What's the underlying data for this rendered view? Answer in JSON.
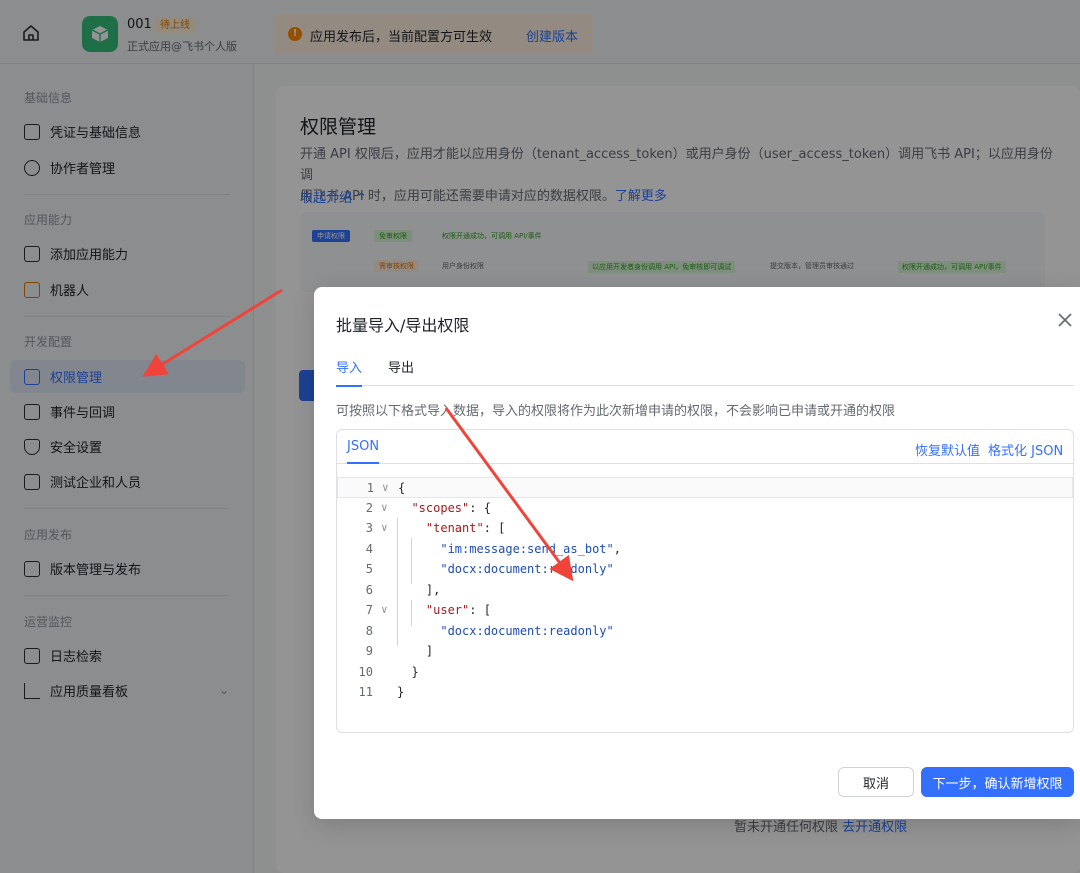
{
  "topbar": {
    "app_name": "001",
    "app_badge": "待上线",
    "app_sub": "正式应用@飞书个人版",
    "notice_text": "应用发布后，当前配置方可生效",
    "notice_link": "创建版本"
  },
  "sidebar": {
    "sections": [
      {
        "title": "基础信息",
        "items": [
          {
            "label": "凭证与基础信息",
            "icon": "credential-icon"
          },
          {
            "label": "协作者管理",
            "icon": "user-icon"
          }
        ]
      },
      {
        "title": "应用能力",
        "items": [
          {
            "label": "添加应用能力",
            "icon": "apps-icon"
          },
          {
            "label": "机器人",
            "icon": "robot-icon"
          }
        ]
      },
      {
        "title": "开发配置",
        "items": [
          {
            "label": "权限管理",
            "icon": "permission-icon"
          },
          {
            "label": "事件与回调",
            "icon": "event-icon"
          },
          {
            "label": "安全设置",
            "icon": "shield-icon"
          },
          {
            "label": "测试企业和人员",
            "icon": "test-icon"
          }
        ]
      },
      {
        "title": "应用发布",
        "items": [
          {
            "label": "版本管理与发布",
            "icon": "upload-icon"
          }
        ]
      },
      {
        "title": "运营监控",
        "items": [
          {
            "label": "日志检索",
            "icon": "log-icon"
          },
          {
            "label": "应用质量看板",
            "icon": "chart-icon"
          }
        ]
      }
    ],
    "active": "权限管理"
  },
  "main": {
    "title": "权限管理",
    "desc_1": "开通 API 权限后，应用才能以应用身份（tenant_access_token）或用户身份（user_access_token）调用飞书 API；以应用身份调",
    "desc_2": "用飞书 API 时，应用可能还需要申请对应的数据权限。",
    "desc_link": "了解更多",
    "collapse": "收起介绍",
    "flow_tag_apply": "申请权限",
    "flow_tag_free": "免审权限",
    "flow_step1": "权限开通成功，可调用 API/事件",
    "flow_tag_review": "需审核权限",
    "flow_user": "用户身份权限",
    "flow_step2": "以应用开发者身份调用 API，免审核即可调试",
    "flow_step3": "提交版本，管理员审核通过",
    "flow_step4": "权限开通成功，可调用 API/事件",
    "bottom_text": "暂未开通任何权限",
    "bottom_link": "去开通权限"
  },
  "modal": {
    "title": "批量导入/导出权限",
    "tab_import": "导入",
    "tab_export": "导出",
    "hint": "可按照以下格式导入数据，导入的权限将作为此次新增申请的权限，不会影响已申请或开通的权限",
    "editor_tab": "JSON",
    "action_reset": "恢复默认值",
    "action_format": "格式化 JSON",
    "code_lines": [
      "{",
      "  \"scopes\": {",
      "    \"tenant\": [",
      "      \"im:message:send_as_bot\",",
      "      \"docx:document:readonly\"",
      "    ],",
      "    \"user\": [",
      "      \"docx:document:readonly\"",
      "    ]",
      "  }",
      "}"
    ],
    "cancel": "取消",
    "next": "下一步，确认新增权限"
  }
}
